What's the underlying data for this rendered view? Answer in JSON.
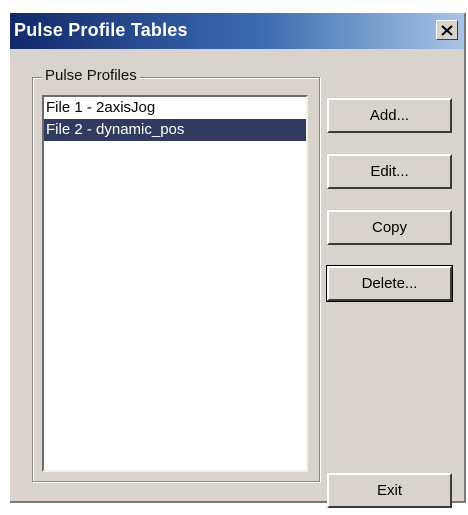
{
  "window": {
    "title": "Pulse Profile Tables",
    "close_icon": "close-icon"
  },
  "group": {
    "label": "Pulse Profiles"
  },
  "profiles": [
    {
      "label": "File 1 - 2axisJog",
      "selected": false
    },
    {
      "label": "File 2 - dynamic_pos",
      "selected": true
    }
  ],
  "buttons": {
    "add": "Add...",
    "edit": "Edit...",
    "copy": "Copy",
    "delete": "Delete...",
    "exit": "Exit"
  },
  "colors": {
    "title_bar_start": "#11296b",
    "selection": "#323a5f",
    "dialog_face": "#d8d3cc"
  }
}
